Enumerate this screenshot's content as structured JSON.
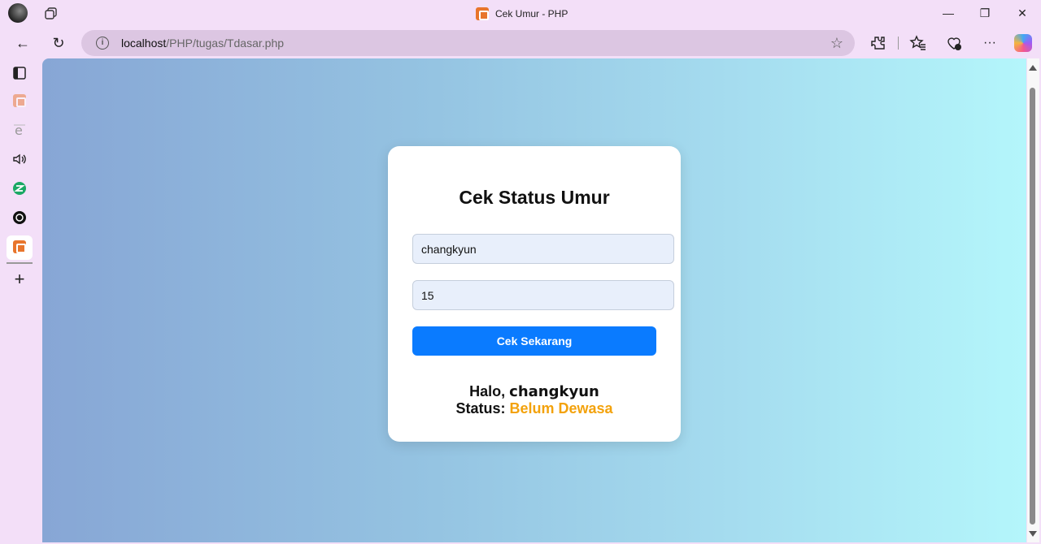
{
  "window": {
    "title": "Cek Umur - PHP",
    "minimize_glyph": "—",
    "restore_glyph": "❐",
    "close_glyph": "✕"
  },
  "toolbar": {
    "url_host": "localhost",
    "url_path": "/PHP/tugas/Tdasar.php",
    "back_glyph": "←",
    "refresh_glyph": "↻",
    "star_glyph": "☆",
    "more_glyph": "···"
  },
  "sidebar": {
    "add_glyph": "+"
  },
  "page": {
    "heading": "Cek Status Umur",
    "name_value": "changkyun",
    "age_value": "15",
    "submit_label": "Cek Sekarang",
    "greeting_label": "Halo,",
    "greeting_name": "changkyun",
    "status_label": "Status:",
    "status_value": "Belum Dewasa"
  },
  "colors": {
    "accent_button": "#0a7bff",
    "status_color": "#f3a20c"
  }
}
